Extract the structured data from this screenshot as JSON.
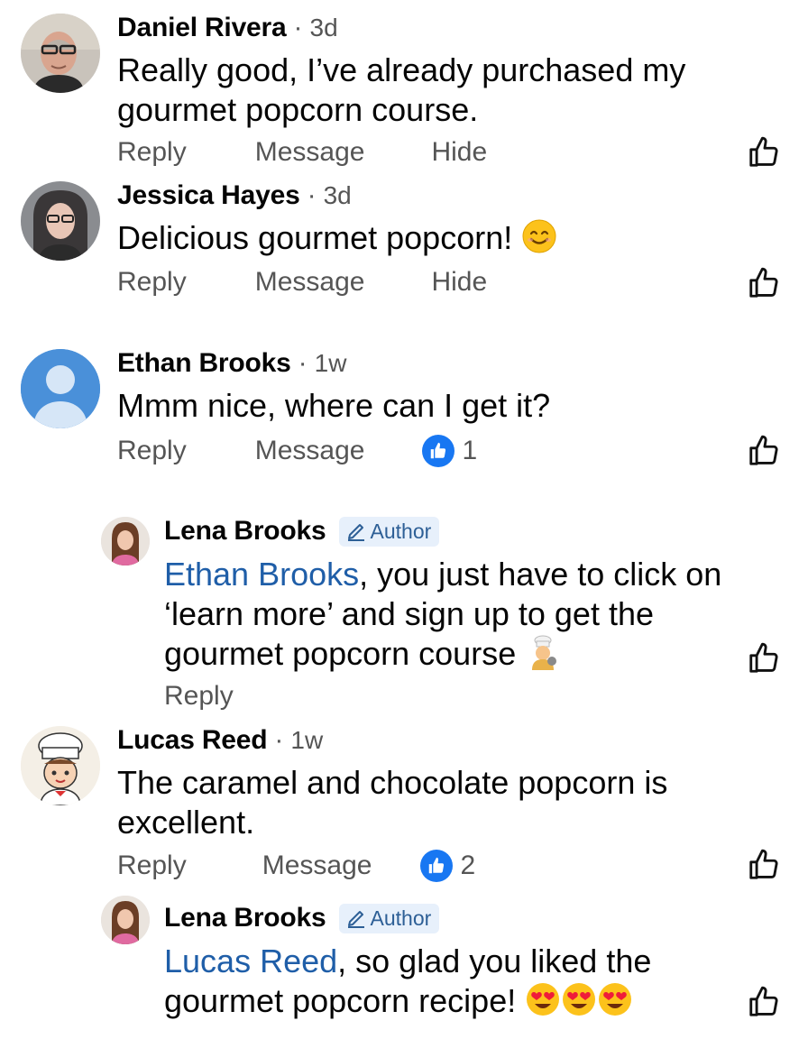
{
  "actions": {
    "reply": "Reply",
    "message": "Message",
    "hide": "Hide"
  },
  "comments": [
    {
      "name": "Daniel Rivera",
      "time": "3d",
      "text": "Really good, I’ve already purchased my gourmet popcorn course."
    },
    {
      "name": "Jessica Hayes",
      "time": "3d",
      "text": "Delicious gourmet popcorn!"
    },
    {
      "name": "Ethan Brooks",
      "time": "1w",
      "text": "Mmm nice, where can I get it?",
      "likes": "1"
    },
    {
      "name": "Lena Brooks",
      "badge": "Author",
      "mention": "Ethan Brooks",
      "text": ", you just have to click on ‘learn more’ and sign up to get the gourmet popcorn course"
    },
    {
      "name": "Lucas Reed",
      "time": "1w",
      "text": "The caramel and chocolate popcorn is excellent.",
      "likes": "2"
    },
    {
      "name": "Lena Brooks",
      "badge": "Author",
      "mention": "Lucas Reed",
      "text": ", so glad you liked the gourmet popcorn recipe!"
    }
  ],
  "separator": "·",
  "colors": {
    "link": "#1f5ea8",
    "like_blue": "#1877f2",
    "badge_bg": "#e7f0fb",
    "meta": "#555555"
  },
  "icons": [
    "thumbs-up-outline-icon",
    "like-reaction-icon",
    "pencil-icon",
    "smiling-face-emoji",
    "cook-emoji",
    "heart-eyes-emoji",
    "default-profile-icon"
  ]
}
